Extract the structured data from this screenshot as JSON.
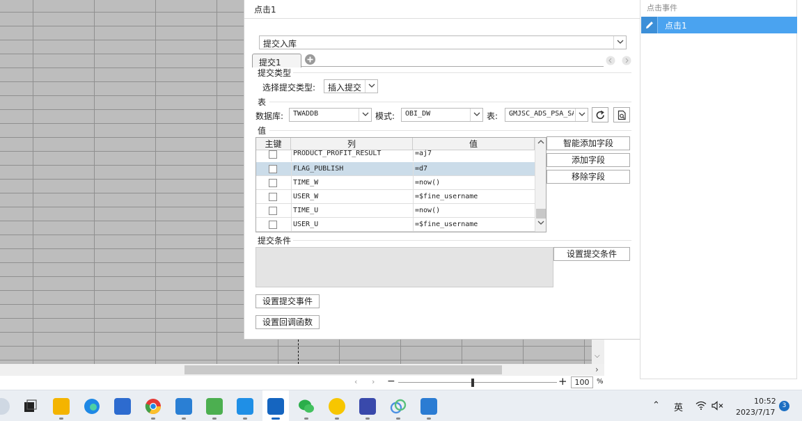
{
  "dialog": {
    "title": "点击1",
    "submit_type_value": "提交入库",
    "tab_label": "提交1",
    "submit_section": {
      "title": "提交类型",
      "select_label": "选择提交类型:",
      "select_value": "插入提交"
    },
    "table_section": {
      "title": "表",
      "db_label": "数据库:",
      "db_value": "TWADDB",
      "schema_label": "模式:",
      "schema_value": "OBI_DW",
      "table_label": "表:",
      "table_value": "GMJSC_ADS_PSA_SA"
    },
    "values_section": {
      "title": "值",
      "columns": [
        "主键",
        "列",
        "值"
      ],
      "rows": [
        {
          "column": "PRODUCT_PROFIT_RESULT",
          "value": "=aj7"
        },
        {
          "column": "FLAG_PUBLISH",
          "value": "=d7"
        },
        {
          "column": "TIME_W",
          "value": "=now()"
        },
        {
          "column": "USER_W",
          "value": "=$fine_username"
        },
        {
          "column": "TIME_U",
          "value": "=now()"
        },
        {
          "column": "USER_U",
          "value": "=$fine_username"
        }
      ],
      "smart_add_label": "智能添加字段",
      "add_label": "添加字段",
      "remove_label": "移除字段"
    },
    "condition_section": {
      "title": "提交条件",
      "set_condition_label": "设置提交条件"
    },
    "set_event_label": "设置提交事件",
    "set_callback_label": "设置回调函数"
  },
  "side_panel": {
    "title": "点击事件",
    "items": [
      "点击1"
    ]
  },
  "zoom": {
    "value": "100",
    "percent": "%"
  },
  "taskbar": {
    "tray_ime": "英",
    "time": "10:52",
    "date": "2023/7/17",
    "notifications": "3"
  },
  "colors": {
    "accent": "#4aa3f0",
    "selected_row": "#cbdce9",
    "sheet_bg": "#bdbdbd"
  }
}
